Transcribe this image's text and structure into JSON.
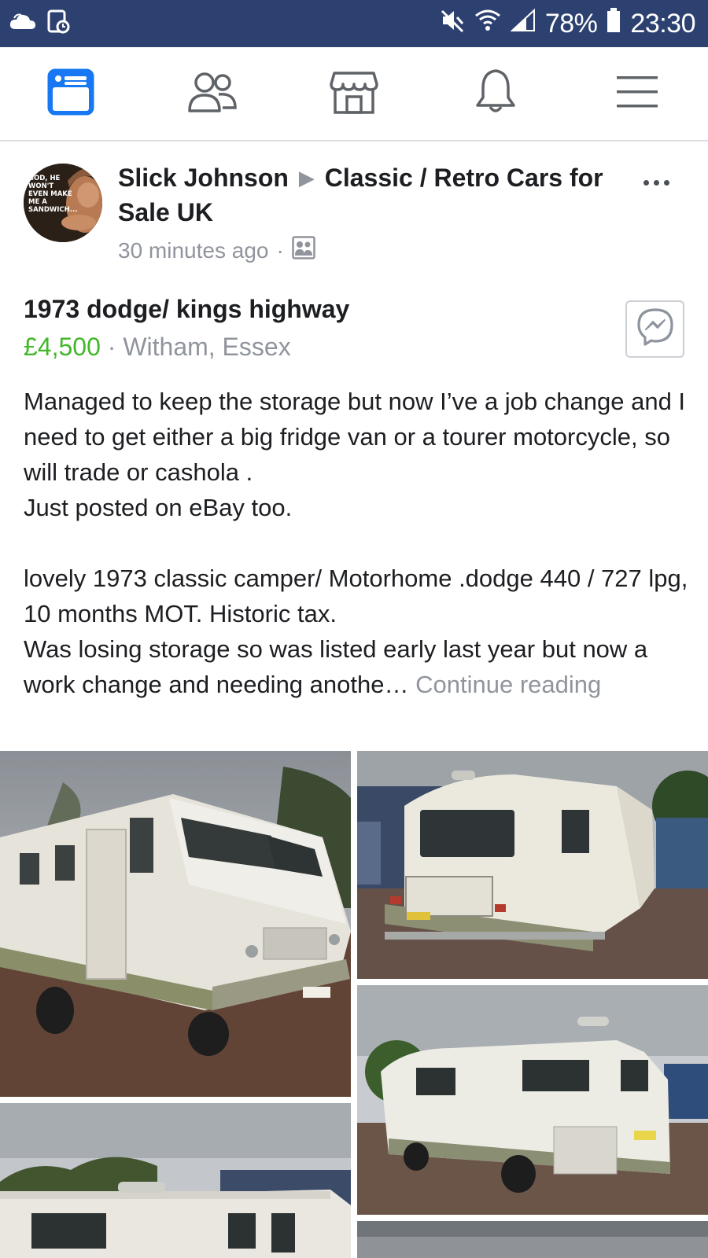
{
  "status_bar": {
    "battery": "78%",
    "time": "23:30",
    "icons": [
      "cloud-icon",
      "screenshot-icon",
      "mute-icon",
      "wifi-icon",
      "signal-icon",
      "battery-icon"
    ]
  },
  "tabs": [
    {
      "name": "news-feed",
      "icon": "news-feed-icon",
      "active": true
    },
    {
      "name": "friends",
      "icon": "friends-icon",
      "active": false
    },
    {
      "name": "marketplace",
      "icon": "marketplace-icon",
      "active": false
    },
    {
      "name": "notifications",
      "icon": "bell-icon",
      "active": false
    },
    {
      "name": "menu",
      "icon": "menu-icon",
      "active": false
    }
  ],
  "post": {
    "author": "Slick Johnson",
    "group": "Classic / Retro Cars for Sale UK",
    "time": "30 minutes ago",
    "separator": "·",
    "avatar_caption": "GOD, HE WON'T EVEN MAKE ME A SANDWICH...",
    "listing": {
      "title": "1973 dodge/ kings highway",
      "price": "£4,500",
      "location": "Witham, Essex"
    },
    "body": {
      "para1": "Managed to keep the storage but now I’ve a job change and I need to get either a big fridge van or a tourer motorcycle, so will trade or cashola .",
      "para2": "Just posted on eBay too.",
      "para3": "lovely 1973 classic camper/ Motorhome .dodge 440 / 727 lpg, 10 months MOT. Historic tax.",
      "para4": "Was losing storage so was listed early last year but now a work change and needing anothe…",
      "continue": "Continue reading"
    },
    "photos": [
      {
        "plate": "SDV 126N"
      },
      {
        "plate": "SDV 126N"
      },
      {
        "plate": ""
      },
      {
        "plate": ""
      }
    ]
  },
  "colors": {
    "status_bar": "#2d4171",
    "accent": "#1877f2",
    "price": "#42b72a",
    "muted": "#90949c"
  }
}
